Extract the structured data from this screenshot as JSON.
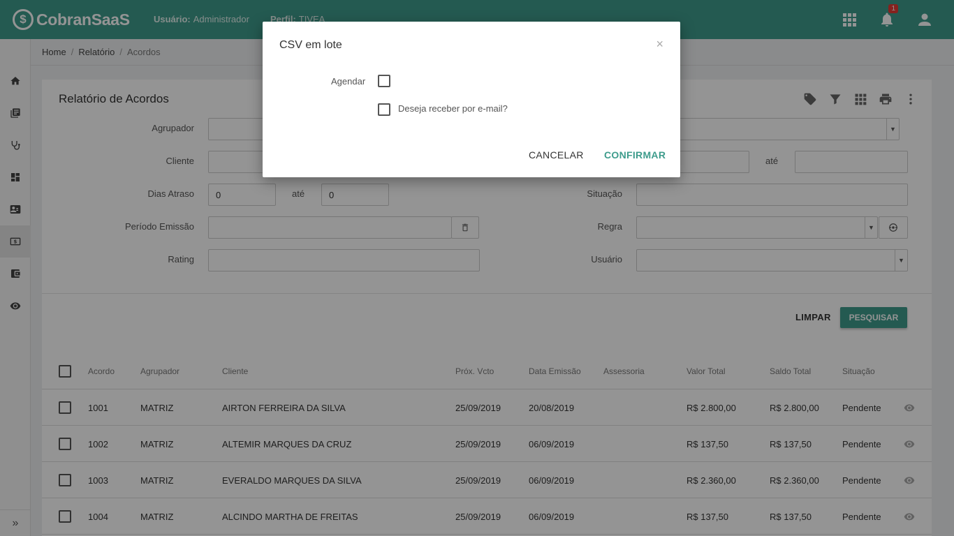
{
  "app": {
    "logo_glyph": "$",
    "logo_text": "CobranSaaS"
  },
  "header": {
    "user_label": "Usuário:",
    "user_value": "Administrador",
    "profile_label": "Perfil:",
    "profile_value": "TIVEA",
    "notification_count": "1",
    "icons": [
      "apps-grid-icon",
      "bell-icon",
      "account-icon"
    ]
  },
  "sidebar": {
    "items": [
      "home-icon",
      "library-icon",
      "stethoscope-icon",
      "dashboard-icon",
      "contact-card-icon",
      "money-icon",
      "wallet-icon",
      "eye-icon"
    ],
    "active_index": 5,
    "expand_glyph": "»"
  },
  "breadcrumb": {
    "items": [
      "Home",
      "Relatório",
      "Acordos"
    ]
  },
  "report": {
    "title": "Relatório de Acordos",
    "tools": [
      "tag-icon",
      "filter-icon",
      "grid-icon",
      "print-icon",
      "more-vert-icon"
    ],
    "fields": {
      "agrupador": "Agrupador",
      "cliente": "Cliente",
      "dias_atraso": "Dias Atraso",
      "dias_atraso_from": "0",
      "dias_atraso_to": "0",
      "ate": "até",
      "periodo_emissao": "Período Emissão",
      "rating": "Rating",
      "situacao": "Situação",
      "regra": "Regra",
      "usuario": "Usuário"
    },
    "buttons": {
      "clear": "LIMPAR",
      "search": "PESQUISAR"
    }
  },
  "table": {
    "headers": [
      "Acordo",
      "Agrupador",
      "Cliente",
      "Próx. Vcto",
      "Data Emissão",
      "Assessoria",
      "Valor Total",
      "Saldo Total",
      "Situação"
    ],
    "rows": [
      {
        "acordo": "1001",
        "agrupador": "MATRIZ",
        "cliente": "AIRTON FERREIRA DA SILVA",
        "prox_vcto": "25/09/2019",
        "data_emissao": "20/08/2019",
        "assessoria": "",
        "valor_total": "R$ 2.800,00",
        "saldo_total": "R$ 2.800,00",
        "situacao": "Pendente"
      },
      {
        "acordo": "1002",
        "agrupador": "MATRIZ",
        "cliente": "ALTEMIR MARQUES DA CRUZ",
        "prox_vcto": "25/09/2019",
        "data_emissao": "06/09/2019",
        "assessoria": "",
        "valor_total": "R$ 137,50",
        "saldo_total": "R$ 137,50",
        "situacao": "Pendente"
      },
      {
        "acordo": "1003",
        "agrupador": "MATRIZ",
        "cliente": "EVERALDO MARQUES DA SILVA",
        "prox_vcto": "25/09/2019",
        "data_emissao": "06/09/2019",
        "assessoria": "",
        "valor_total": "R$ 2.360,00",
        "saldo_total": "R$ 2.360,00",
        "situacao": "Pendente"
      },
      {
        "acordo": "1004",
        "agrupador": "MATRIZ",
        "cliente": "ALCINDO MARTHA DE FREITAS",
        "prox_vcto": "25/09/2019",
        "data_emissao": "06/09/2019",
        "assessoria": "",
        "valor_total": "R$ 137,50",
        "saldo_total": "R$ 137,50",
        "situacao": "Pendente"
      }
    ]
  },
  "modal": {
    "title": "CSV em lote",
    "close_glyph": "×",
    "schedule_label": "Agendar",
    "email_label": "Deseja receber por e-mail?",
    "cancel": "CANCELAR",
    "confirm": "CONFIRMAR"
  },
  "colors": {
    "primary": "#3e9c8c",
    "badge": "#e53935",
    "overlay": "rgba(0,0,0,0.42)"
  }
}
